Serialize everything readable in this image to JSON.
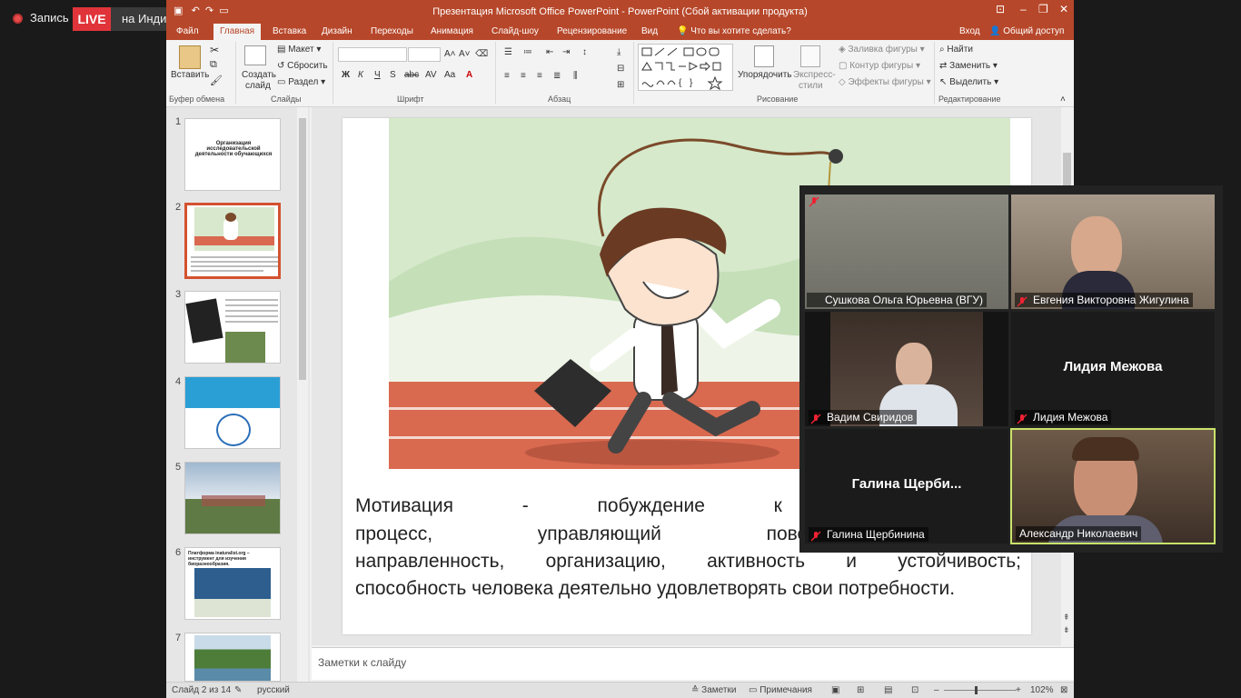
{
  "recorder": {
    "label": "Запись",
    "live": "LIVE",
    "stream_label": "на Индивидуальная служба потокового вещания"
  },
  "window": {
    "title": "Презентация Microsoft Office PowerPoint - PowerPoint (Сбой активации продукта)",
    "min": "–",
    "restore": "❐",
    "close": "✕",
    "opts": "⊡"
  },
  "tabs": [
    {
      "label": "Файл"
    },
    {
      "label": "Главная"
    },
    {
      "label": "Вставка"
    },
    {
      "label": "Дизайн"
    },
    {
      "label": "Переходы"
    },
    {
      "label": "Анимация"
    },
    {
      "label": "Слайд-шоу"
    },
    {
      "label": "Рецензирование"
    },
    {
      "label": "Вид"
    }
  ],
  "tellme": "Что вы хотите сделать?",
  "signin": "Вход",
  "share": "Общий доступ",
  "ribbon": {
    "paste": "Вставить",
    "new_slide_1": "Создать",
    "new_slide_2": "слайд",
    "layout": "Макет",
    "reset": "Сбросить",
    "section": "Раздел",
    "arrange": "Упорядочить",
    "quick_styles_1": "Экспресс-",
    "quick_styles_2": "стили",
    "shape_fill": "Заливка фигуры",
    "shape_outline": "Контур фигуры",
    "shape_effects": "Эффекты фигуры",
    "find": "Найти",
    "replace": "Заменить",
    "select": "Выделить",
    "groups": {
      "clipboard": "Буфер обмена",
      "slides": "Слайды",
      "font": "Шрифт",
      "paragraph": "Абзац",
      "drawing": "Рисование",
      "editing": "Редактирование"
    },
    "font_btns": [
      "Ж",
      "К",
      "Ч",
      "S",
      "abc",
      "AV",
      "Aa"
    ]
  },
  "thumbnails": [
    {
      "num": "1",
      "title": "Организация исследовательской деятельности обучающихся"
    },
    {
      "num": "2"
    },
    {
      "num": "3"
    },
    {
      "num": "4"
    },
    {
      "num": "5"
    },
    {
      "num": "6",
      "title": "Платформа inaturalist.org – инструмент для изучения биоразнообразия."
    },
    {
      "num": "7"
    }
  ],
  "slide_text": {
    "line1": "Мотивация - побуждение к действию; п",
    "line2": "процесс, управляющий поведением чело",
    "line3": "направленность, организацию, активность и устойчивость;",
    "line4": "способность человека деятельно удовлетворять свои потребности."
  },
  "notes_placeholder": "Заметки к слайду",
  "status": {
    "slide": "Слайд 2 из 14",
    "lang": "русский",
    "notes": "Заметки",
    "comments": "Примечания",
    "zoom": "102%"
  },
  "participants": [
    {
      "name": "Сушкова Ольга Юрьевна (ВГУ)",
      "video": true
    },
    {
      "name": "Евгения Викторовна Жигулина",
      "video": true
    },
    {
      "name": "Вадим Свиридов",
      "video": true
    },
    {
      "name": "Лидия Межова",
      "display": "Лидия Межова",
      "video": false
    },
    {
      "name": "Галина Щербинина",
      "display": "Галина  Щерби...",
      "video": false
    },
    {
      "name": "Александр Николаевич",
      "video": true,
      "active": true
    }
  ],
  "colors": {
    "accent": "#b7472a",
    "live": "#e0343a",
    "active_speaker": "#c9e36b"
  }
}
